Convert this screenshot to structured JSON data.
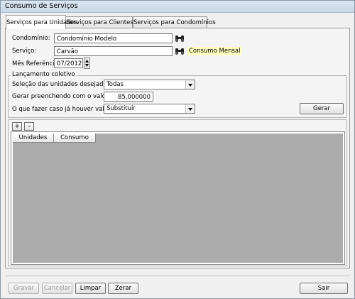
{
  "window": {
    "title": "Consumo de Serviços"
  },
  "tabs": [
    {
      "label": "Serviços para Unidades",
      "active": true
    },
    {
      "label": "Serviços para Clientes",
      "active": false
    },
    {
      "label": "Serviços para Condomínios",
      "active": false
    }
  ],
  "form": {
    "condominio_label": "Condomínio:",
    "condominio_value": "Condomínio Modelo",
    "servico_label": "Serviço:",
    "servico_value": "Carvão",
    "servico_hint": "Consumo Mensal",
    "mes_label": "Mês Referência:",
    "mes_value": "07/2012"
  },
  "lancamento": {
    "legend": "Lançamento coletivo",
    "selecao_label": "Seleção das unidades desejadas:",
    "selecao_value": "Todas",
    "gerar_valor_label": "Gerar preenchendo com o valor:",
    "gerar_valor_value": "85,000000",
    "fazer_label": "O que fazer caso já houver valores?",
    "fazer_value": "Substituir",
    "gerar_button": "Gerar"
  },
  "grid": {
    "add_button": "+",
    "remove_button": "-",
    "columns": [
      "Unidades",
      "Consumo"
    ]
  },
  "footer": {
    "gravar": "Gravar",
    "cancelar": "Cancelar",
    "limpar": "Limpar",
    "zerar": "Zerar",
    "sair": "Sair"
  }
}
